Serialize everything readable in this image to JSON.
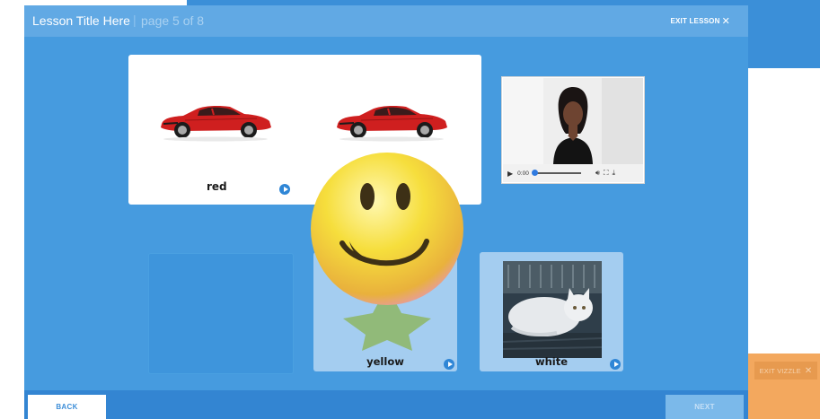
{
  "header": {
    "lesson_title": "Lesson Title Here",
    "separator": "|",
    "page_info": "page 5 of 8",
    "exit_label": "EXIT LESSON",
    "exit_icon": "close-icon"
  },
  "cards": {
    "top": {
      "label": "red",
      "images": [
        "red-car",
        "red-car"
      ]
    },
    "answers": [
      {
        "label": ""
      },
      {
        "label": "yellow"
      },
      {
        "label": "white"
      }
    ]
  },
  "video": {
    "time": "0:00",
    "progress": 0,
    "icons": [
      "play-icon",
      "volume-icon",
      "fullscreen-icon",
      "download-icon"
    ]
  },
  "footer": {
    "back_label": "BACK",
    "next_label": "NEXT"
  },
  "background_app": {
    "exit_label": "EXIT VIZZLE"
  },
  "colors": {
    "lesson_bg": "#469bdf",
    "header_bg": "#61a9e4",
    "footer_bg": "#3385d2",
    "answer_card": "#a4cdf0",
    "accent_orange": "#f3a85e",
    "play_button": "#2f86d6"
  }
}
